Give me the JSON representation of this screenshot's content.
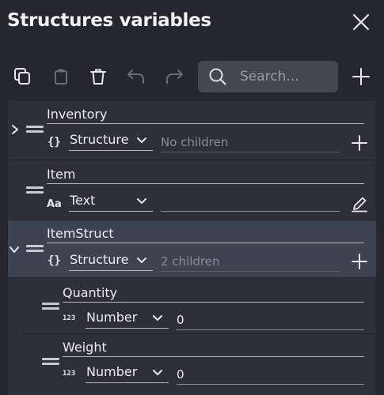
{
  "panel": {
    "title": "Structures variables"
  },
  "toolbar": {
    "search_placeholder": "Search..."
  },
  "variables": [
    {
      "name": "Inventory",
      "type_icon": "{}",
      "type": "Structure",
      "value": "No children",
      "expanded": false
    },
    {
      "name": "Item",
      "type_icon": "Aa",
      "type": "Text",
      "value": "",
      "action": "edit-icon"
    },
    {
      "name": "ItemStruct",
      "type_icon": "{}",
      "type": "Structure",
      "value": "2 children",
      "expanded": true,
      "selected": true
    },
    {
      "name": "Quantity",
      "type_icon": "123",
      "type": "Number",
      "value": "0",
      "parent": "ItemStruct"
    },
    {
      "name": "Weight",
      "type_icon": "123",
      "type": "Number",
      "value": "0",
      "parent": "ItemStruct"
    }
  ],
  "colors": {
    "background": "#26262e",
    "list_background": "#2f2f37",
    "selected_row": "#3d4350",
    "search_background": "#464651"
  }
}
